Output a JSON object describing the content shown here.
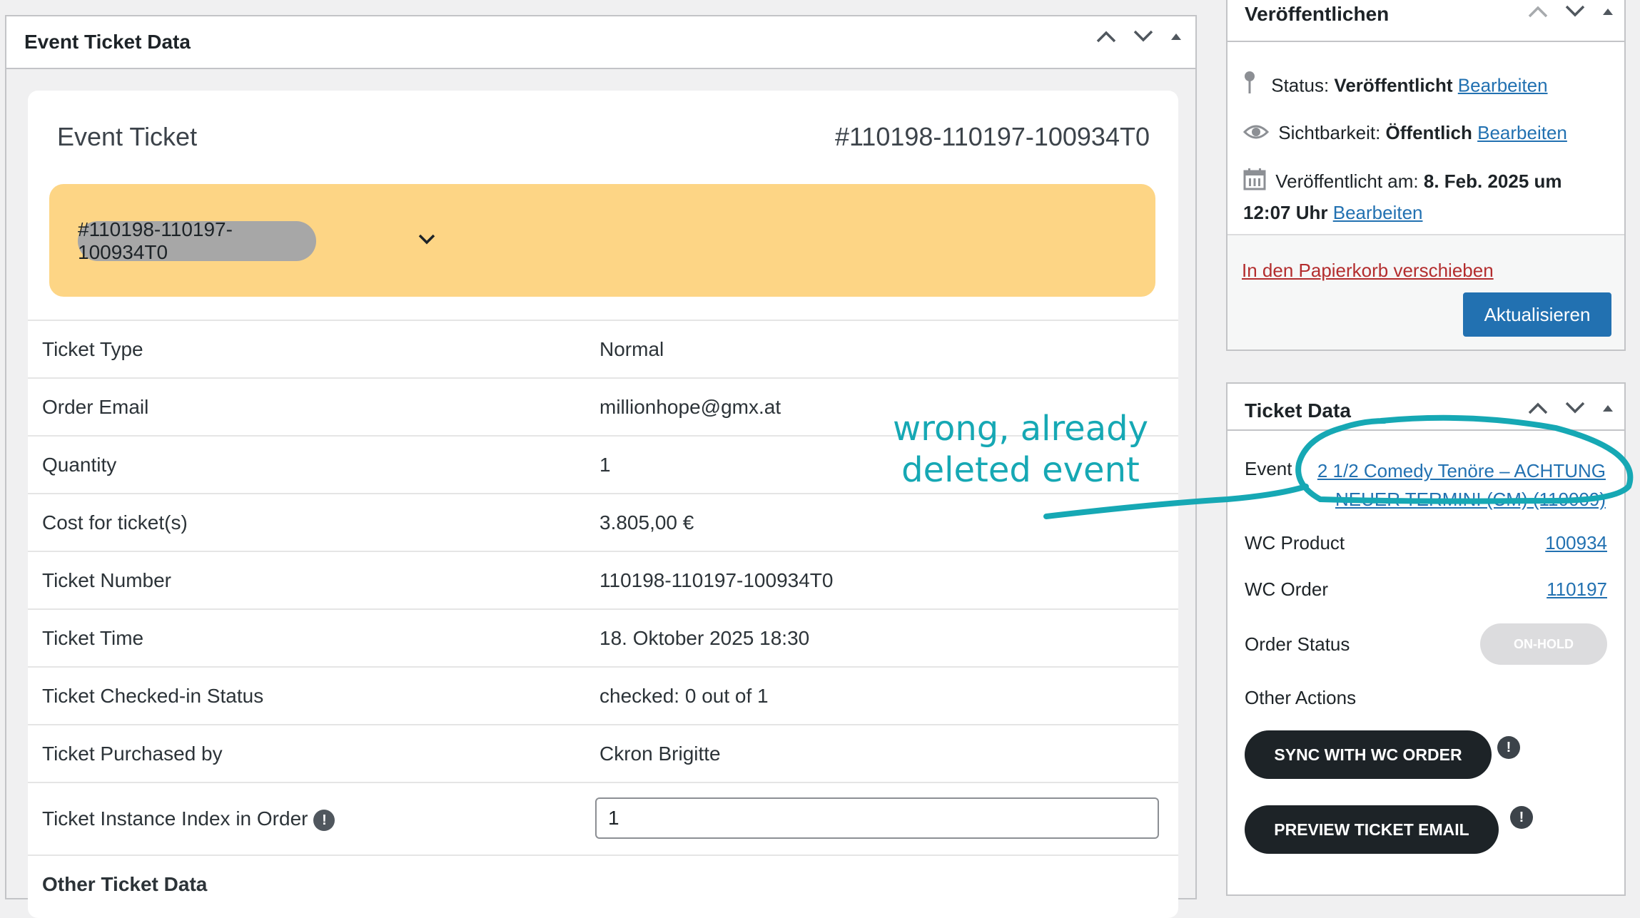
{
  "left_panel": {
    "title": "Event Ticket Data",
    "card": {
      "title": "Event Ticket",
      "ticket_id": "#110198-110197-100934T0",
      "dropdown_selected": "#110198-110197-100934T0"
    },
    "rows": [
      {
        "label": "Ticket Type",
        "value": "Normal"
      },
      {
        "label": "Order Email",
        "value": "millionhope@gmx.at"
      },
      {
        "label": "Quantity",
        "value": "1"
      },
      {
        "label": "Cost for ticket(s)",
        "value": "3.805,00 €"
      },
      {
        "label": "Ticket Number",
        "value": "110198-110197-100934T0"
      },
      {
        "label": "Ticket Time",
        "value": "18. Oktober 2025 18:30"
      },
      {
        "label": "Ticket Checked-in Status",
        "value": "checked: 0 out of 1"
      },
      {
        "label": "Ticket Purchased by",
        "value": "Ckron Brigitte"
      }
    ],
    "instance_index": {
      "label": "Ticket Instance Index in Order",
      "value": "1"
    },
    "other_heading": "Other Ticket Data"
  },
  "publish": {
    "title": "Veröffentlichen",
    "status_label": "Status:",
    "status_value": "Veröffentlicht",
    "visibility_label": "Sichtbarkeit:",
    "visibility_value": "Öffentlich",
    "published_label": "Veröffentlicht am:",
    "published_value_1": "8. Feb. 2025 um",
    "published_value_2": "12:07 Uhr",
    "edit_link": "Bearbeiten",
    "trash_link": "In den Papierkorb verschieben",
    "update_button": "Aktualisieren"
  },
  "ticket_data": {
    "title": "Ticket Data",
    "event_label": "Event",
    "event_link_1": "2 1/2 Comedy Tenöre – ACHTUNG",
    "event_link_2": "NEUER TERMIN! (CM) (110009)",
    "product_label": "WC Product",
    "product_value": "100934",
    "order_label": "WC Order",
    "order_value": "110197",
    "order_status_label": "Order Status",
    "order_status_value": "ON-HOLD",
    "other_actions_label": "Other Actions",
    "sync_button": "SYNC WITH WC ORDER",
    "preview_button": "PREVIEW TICKET EMAIL"
  },
  "annotation": {
    "line1": "wrong, already",
    "line2": "deleted event",
    "color": "#16a8b4"
  },
  "colors": {
    "accent": "#2271b1",
    "yellow": "#fdd585",
    "trash": "#b32d2e"
  }
}
